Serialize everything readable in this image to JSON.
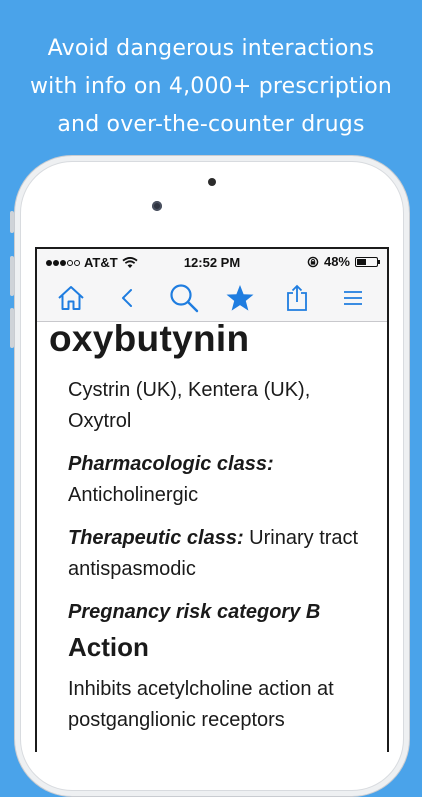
{
  "promo": {
    "headline_lines": [
      "Avoid dangerous interactions",
      "with info on 4,000+ prescription",
      "and over-the-counter drugs"
    ]
  },
  "status_bar": {
    "carrier": "AT&T",
    "time": "12:52 PM",
    "battery": "48%",
    "battery_level": 0.48
  },
  "toolbar": {
    "icons": [
      "home-icon",
      "back-icon",
      "search-icon",
      "favorite-star-icon",
      "share-icon",
      "menu-icon"
    ],
    "accent_color": "#1f7de0"
  },
  "drug": {
    "name": "oxybutynin",
    "brand_names": "Cystrin (UK), Kentera (UK), Oxytrol",
    "pharmacologic_class_label": "Pharmacologic class:",
    "pharmacologic_class_value": "Anticholinergic",
    "therapeutic_class_label": "Therapeutic class:",
    "therapeutic_class_value": " Urinary tract antispasmodic",
    "pregnancy_label": "Pregnancy risk category B",
    "action_heading": "Action",
    "action_text": "Inhibits acetylcholine action at postganglionic receptors"
  }
}
